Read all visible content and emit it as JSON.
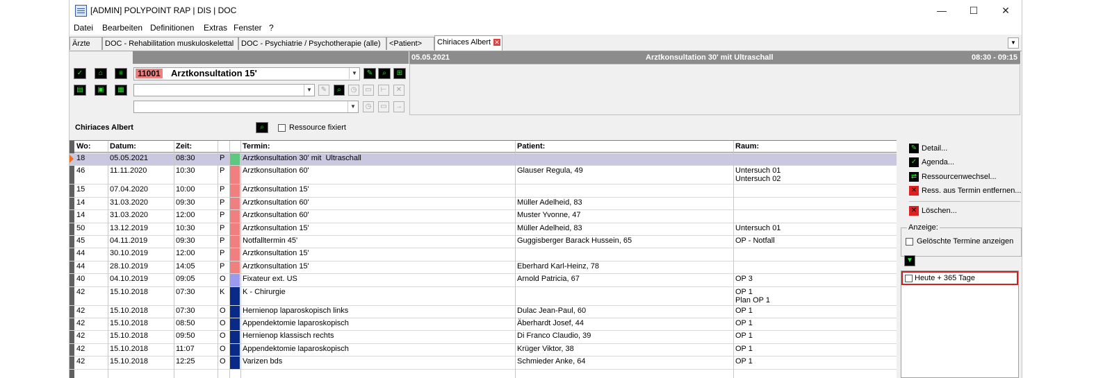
{
  "window": {
    "title": "[ADMIN] POLYPOINT RAP | DIS | DOC",
    "controls": {
      "minimize": "—",
      "maximize": "☐",
      "close": "✕"
    }
  },
  "menu": [
    "Datei",
    "Bearbeiten",
    "Definitionen",
    "Extras",
    "Fenster",
    "?"
  ],
  "tabs": [
    {
      "label": "Ärzte"
    },
    {
      "label": "DOC - Rehabilitation muskuloskelettal"
    },
    {
      "label": "DOC - Psychiatrie / Psychotherapie (alle)"
    },
    {
      "label": "<Patient>"
    },
    {
      "label": "Chiriaces Albert",
      "active": true
    }
  ],
  "appointment_header": {
    "date": "05.05.2021",
    "title": "Arztkonsultation 30' mit  Ultraschall",
    "time": "08:30 - 09:15"
  },
  "service": {
    "code": "11001",
    "name": "Arztkonsultation 15'"
  },
  "resource": {
    "name": "Chiriaces Albert",
    "fix_label": "Ressource fixiert",
    "fix_checked": false
  },
  "table": {
    "headers": [
      "Wo:",
      "Datum:",
      "Zeit:",
      "",
      "",
      "Termin:",
      "Patient:",
      "Raum:"
    ],
    "rows": [
      {
        "wo": "18",
        "datum": "05.05.2021",
        "zeit": "08:30",
        "typ": "P",
        "color": "#5ec882",
        "termin": "Arztkonsultation 30' mit  Ultraschall",
        "patient": "",
        "raum": "",
        "selected": true
      },
      {
        "wo": "46",
        "datum": "11.11.2020",
        "zeit": "10:30",
        "typ": "P",
        "color": "#f08080",
        "termin": "Arztkonsultation 60'",
        "patient": "Glauser Regula, 49",
        "raum": "Untersuch 01\nUntersuch 02"
      },
      {
        "wo": "15",
        "datum": "07.04.2020",
        "zeit": "10:00",
        "typ": "P",
        "color": "#f08080",
        "termin": "Arztkonsultation 15'",
        "patient": "",
        "raum": ""
      },
      {
        "wo": "14",
        "datum": "31.03.2020",
        "zeit": "09:30",
        "typ": "P",
        "color": "#f08080",
        "termin": "Arztkonsultation 60'",
        "patient": "Müller Adelheid, 83",
        "raum": ""
      },
      {
        "wo": "14",
        "datum": "31.03.2020",
        "zeit": "12:00",
        "typ": "P",
        "color": "#f08080",
        "termin": "Arztkonsultation 60'",
        "patient": "Muster Yvonne, 47",
        "raum": ""
      },
      {
        "wo": "50",
        "datum": "13.12.2019",
        "zeit": "10:30",
        "typ": "P",
        "color": "#f08080",
        "termin": "Arztkonsultation 15'",
        "patient": "Müller Adelheid, 83",
        "raum": "Untersuch 01"
      },
      {
        "wo": "45",
        "datum": "04.11.2019",
        "zeit": "09:30",
        "typ": "P",
        "color": "#f08080",
        "termin": "Notfalltermin 45'",
        "patient": "Guggisberger Barack Hussein, 65",
        "raum": "OP - Notfall"
      },
      {
        "wo": "44",
        "datum": "30.10.2019",
        "zeit": "12:00",
        "typ": "P",
        "color": "#f08080",
        "termin": "Arztkonsultation 15'",
        "patient": "",
        "raum": ""
      },
      {
        "wo": "44",
        "datum": "28.10.2019",
        "zeit": "14:05",
        "typ": "P",
        "color": "#f08080",
        "termin": "Arztkonsultation 15'",
        "patient": "Eberhard Karl-Heinz, 78",
        "raum": ""
      },
      {
        "wo": "40",
        "datum": "04.10.2019",
        "zeit": "09:05",
        "typ": "O",
        "color": "#9a9af0",
        "termin": "Fixateur ext. US",
        "patient": "Arnold Patricia, 67",
        "raum": "OP 3"
      },
      {
        "wo": "42",
        "datum": "15.10.2018",
        "zeit": "07:30",
        "typ": "K",
        "color": "#0a2a8a",
        "termin": "K - Chirurgie",
        "patient": "",
        "raum": "OP 1\nPlan OP 1"
      },
      {
        "wo": "42",
        "datum": "15.10.2018",
        "zeit": "07:30",
        "typ": "O",
        "color": "#0a2a8a",
        "termin": "Hernienop laparoskopisch links",
        "patient": "Dulac Jean-Paul, 60",
        "raum": "OP 1"
      },
      {
        "wo": "42",
        "datum": "15.10.2018",
        "zeit": "08:50",
        "typ": "O",
        "color": "#0a2a8a",
        "termin": "Appendektomie laparoskopisch",
        "patient": "Äberhardt Josef, 44",
        "raum": "OP 1"
      },
      {
        "wo": "42",
        "datum": "15.10.2018",
        "zeit": "09:50",
        "typ": "O",
        "color": "#0a2a8a",
        "termin": "Hernienop klassisch rechts",
        "patient": "Di Franco Claudio, 39",
        "raum": "OP 1"
      },
      {
        "wo": "42",
        "datum": "15.10.2018",
        "zeit": "11:07",
        "typ": "O",
        "color": "#0a2a8a",
        "termin": "Appendektomie laparoskopisch",
        "patient": "Krüger Viktor, 38",
        "raum": "OP 1"
      },
      {
        "wo": "42",
        "datum": "15.10.2018",
        "zeit": "12:25",
        "typ": "O",
        "color": "#0a2a8a",
        "termin": "Varizen bds",
        "patient": "Schmieder Anke, 64",
        "raum": "OP 1"
      }
    ]
  },
  "sidebar": {
    "actions": [
      {
        "label": "Detail...",
        "icon": "detail-icon",
        "color": "#2ee62e"
      },
      {
        "label": "Agenda...",
        "icon": "agenda-icon",
        "color": "#2ee62e"
      },
      {
        "label": "Ressourcenwechsel...",
        "icon": "swap-icon",
        "color": "#2ee62e"
      },
      {
        "label": "Ress. aus Termin entfernen...",
        "icon": "remove-icon",
        "color": "#e02020"
      }
    ],
    "delete_label": "Löschen...",
    "anzeige_title": "Anzeige:",
    "show_deleted_label": "Gelöschte Termine anzeigen",
    "show_deleted_checked": false,
    "filter_label": "Heute + 365 Tage",
    "filter_checked": false
  }
}
